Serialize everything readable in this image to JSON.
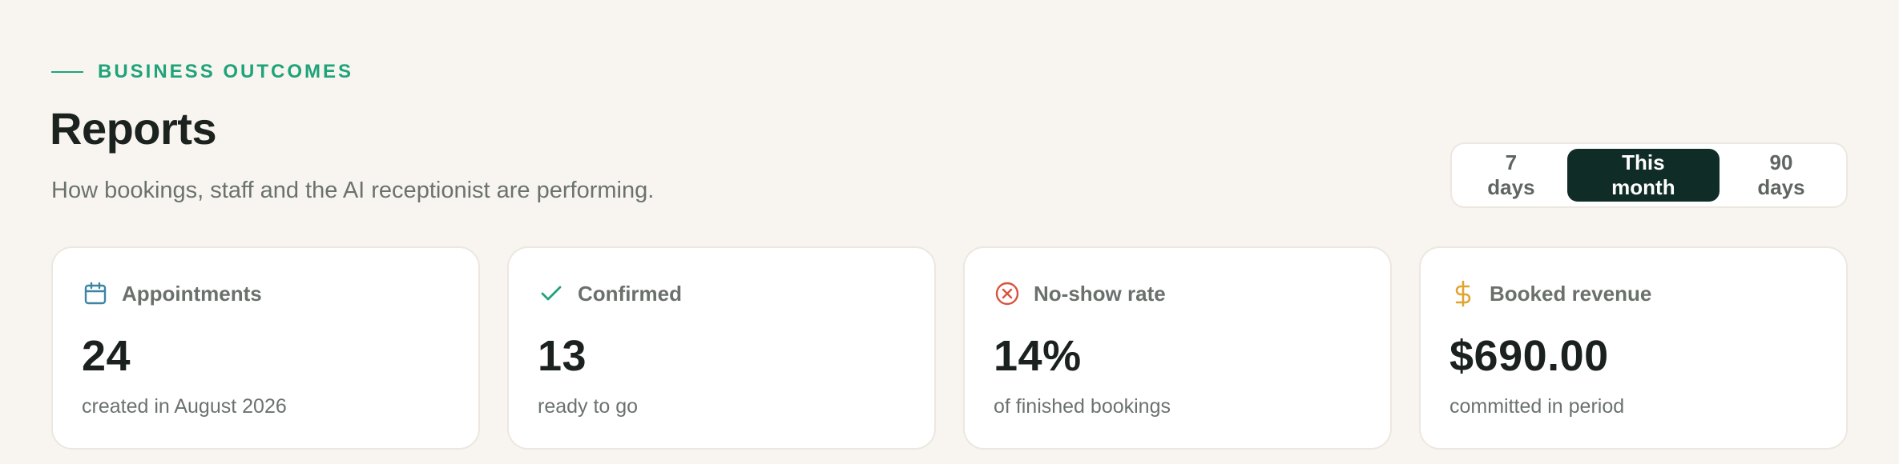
{
  "header": {
    "eyebrow": "BUSINESS OUTCOMES",
    "title": "Reports",
    "subtitle": "How bookings, staff and the AI receptionist are performing."
  },
  "range_switch": {
    "options": [
      "7 days",
      "This month",
      "90 days"
    ],
    "selected": "This month"
  },
  "cards": [
    {
      "label": "Appointments",
      "value": "24",
      "note": "created in August 2026",
      "icon": "calendar-icon",
      "icon_color": "#3c86a3"
    },
    {
      "label": "Confirmed",
      "value": "13",
      "note": "ready to go",
      "icon": "check-icon",
      "icon_color": "#1fa37a"
    },
    {
      "label": "No-show rate",
      "value": "14%",
      "note": "of finished bookings",
      "icon": "x-circle-icon",
      "icon_color": "#d9533f"
    },
    {
      "label": "Booked revenue",
      "value": "$690.00",
      "note": "committed in period",
      "icon": "dollar-icon",
      "icon_color": "#e0a530"
    }
  ],
  "colors": {
    "background": "#f8f5f0",
    "accent": "#1fa37a",
    "active_tab": "#0f2d26"
  }
}
